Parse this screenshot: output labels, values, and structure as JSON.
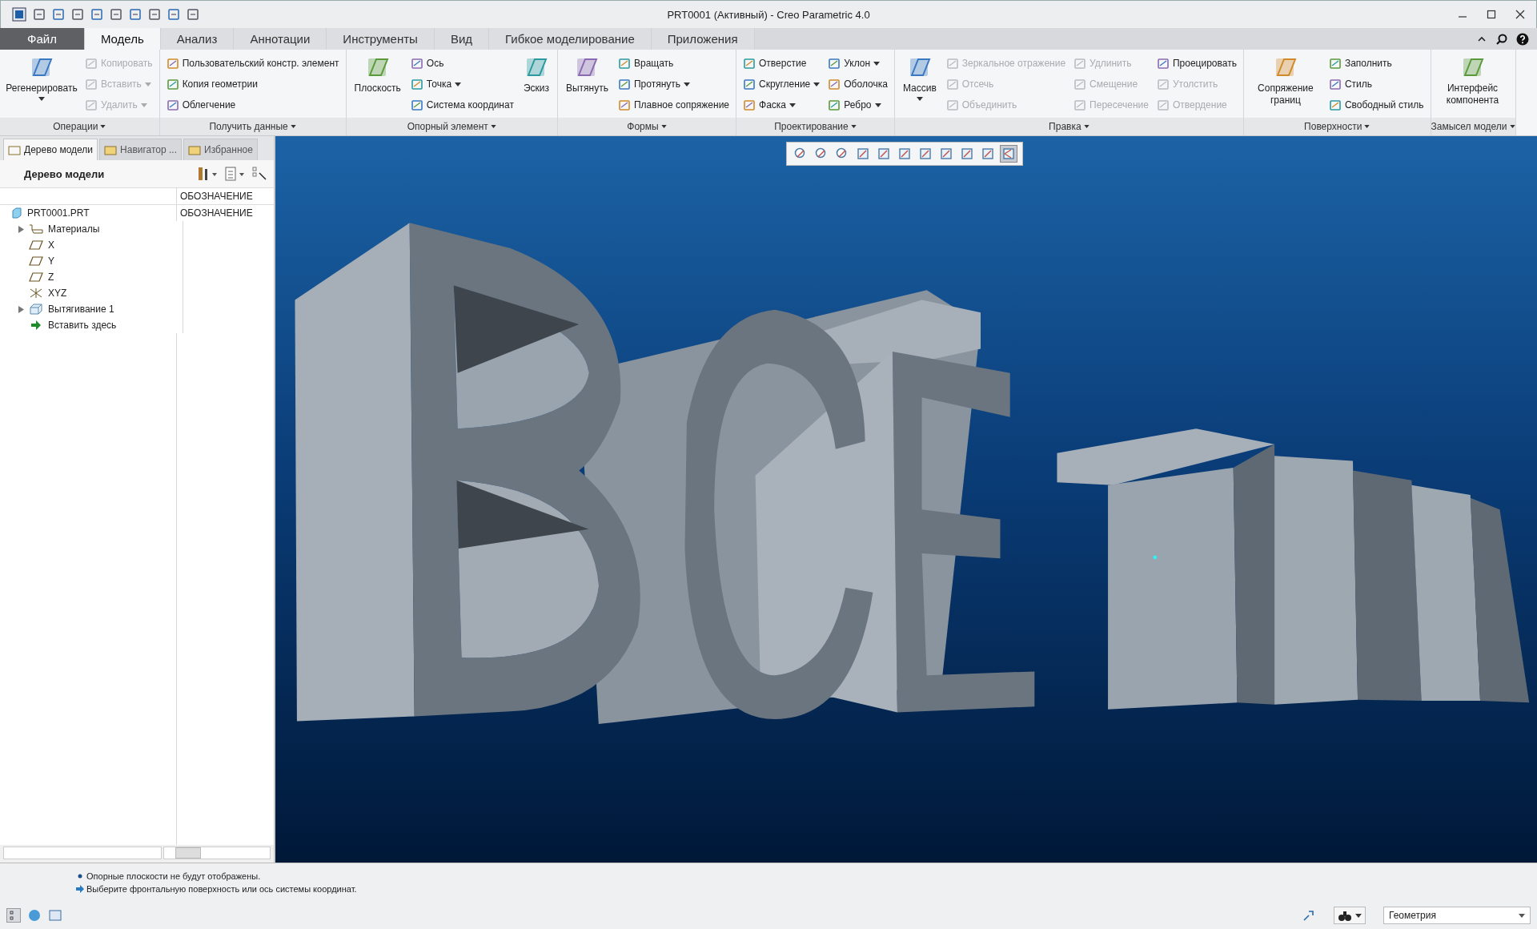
{
  "window": {
    "title": "PRT0001 (Активный) - Creo Parametric 4.0"
  },
  "tabs": [
    {
      "label": "Файл",
      "kind": "file",
      "selected": false
    },
    {
      "label": "Модель",
      "kind": "tab",
      "selected": true
    },
    {
      "label": "Анализ",
      "kind": "tab",
      "selected": false
    },
    {
      "label": "Аннотации",
      "kind": "tab",
      "selected": false
    },
    {
      "label": "Инструменты",
      "kind": "tab",
      "selected": false
    },
    {
      "label": "Вид",
      "kind": "tab",
      "selected": false
    },
    {
      "label": "Гибкое моделирование",
      "kind": "tab",
      "selected": false
    },
    {
      "label": "Приложения",
      "kind": "tab",
      "selected": false
    }
  ],
  "ribbon": [
    {
      "label": "Операции",
      "columns": [
        [
          {
            "label": "Регенерировать",
            "kind": "large",
            "dropdown": true,
            "disabled": false
          }
        ],
        [
          {
            "label": "Копировать",
            "kind": "small",
            "dropdown": false,
            "disabled": true
          },
          {
            "label": "Вставить",
            "kind": "small",
            "dropdown": true,
            "disabled": true
          },
          {
            "label": "Удалить",
            "kind": "small",
            "dropdown": true,
            "disabled": true
          }
        ]
      ]
    },
    {
      "label": "Получить данные",
      "columns": [
        [
          {
            "label": "Пользовательский констр. элемент",
            "kind": "small",
            "dropdown": false,
            "disabled": false
          },
          {
            "label": "Копия геометрии",
            "kind": "small",
            "dropdown": false,
            "disabled": false
          },
          {
            "label": "Облегчение",
            "kind": "small",
            "dropdown": false,
            "disabled": false
          }
        ]
      ]
    },
    {
      "label": "Опорный элемент",
      "columns": [
        [
          {
            "label": "Плоскость",
            "kind": "large",
            "dropdown": false,
            "disabled": false
          }
        ],
        [
          {
            "label": "Ось",
            "kind": "small",
            "dropdown": false,
            "disabled": false
          },
          {
            "label": "Точка",
            "kind": "small",
            "dropdown": true,
            "disabled": false
          },
          {
            "label": "Система координат",
            "kind": "small",
            "dropdown": false,
            "disabled": false
          }
        ],
        [
          {
            "label": "Эскиз",
            "kind": "large",
            "dropdown": false,
            "disabled": false
          }
        ]
      ]
    },
    {
      "label": "Формы",
      "columns": [
        [
          {
            "label": "Вытянуть",
            "kind": "large",
            "dropdown": false,
            "disabled": false
          }
        ],
        [
          {
            "label": "Вращать",
            "kind": "small",
            "dropdown": false,
            "disabled": false
          },
          {
            "label": "Протянуть",
            "kind": "small",
            "dropdown": true,
            "disabled": false
          },
          {
            "label": "Плавное сопряжение",
            "kind": "small",
            "dropdown": false,
            "disabled": false
          }
        ]
      ]
    },
    {
      "label": "Проектирование",
      "columns": [
        [
          {
            "label": "Отверстие",
            "kind": "small",
            "dropdown": false,
            "disabled": false
          },
          {
            "label": "Скругление",
            "kind": "small",
            "dropdown": true,
            "disabled": false
          },
          {
            "label": "Фаска",
            "kind": "small",
            "dropdown": true,
            "disabled": false
          }
        ],
        [
          {
            "label": "Уклон",
            "kind": "small",
            "dropdown": true,
            "disabled": false
          },
          {
            "label": "Оболочка",
            "kind": "small",
            "dropdown": false,
            "disabled": false
          },
          {
            "label": "Ребро",
            "kind": "small",
            "dropdown": true,
            "disabled": false
          }
        ]
      ]
    },
    {
      "label": "Правка",
      "columns": [
        [
          {
            "label": "Массив",
            "kind": "large",
            "dropdown": true,
            "disabled": false
          }
        ],
        [
          {
            "label": "Зеркальное отражение",
            "kind": "small",
            "dropdown": false,
            "disabled": true
          },
          {
            "label": "Отсечь",
            "kind": "small",
            "dropdown": false,
            "disabled": true
          },
          {
            "label": "Объединить",
            "kind": "small",
            "dropdown": false,
            "disabled": true
          }
        ],
        [
          {
            "label": "Удлинить",
            "kind": "small",
            "dropdown": false,
            "disabled": true
          },
          {
            "label": "Смещение",
            "kind": "small",
            "dropdown": false,
            "disabled": true
          },
          {
            "label": "Пересечение",
            "kind": "small",
            "dropdown": false,
            "disabled": true
          }
        ],
        [
          {
            "label": "Проецировать",
            "kind": "small",
            "dropdown": false,
            "disabled": false
          },
          {
            "label": "Утолстить",
            "kind": "small",
            "dropdown": false,
            "disabled": true
          },
          {
            "label": "Отвердение",
            "kind": "small",
            "dropdown": false,
            "disabled": true
          }
        ]
      ]
    },
    {
      "label": "Поверхности",
      "columns": [
        [
          {
            "label": "Сопряжение границ",
            "kind": "large",
            "dropdown": false,
            "disabled": false
          }
        ],
        [
          {
            "label": "Заполнить",
            "kind": "small",
            "dropdown": false,
            "disabled": false
          },
          {
            "label": "Стиль",
            "kind": "small",
            "dropdown": false,
            "disabled": false
          },
          {
            "label": "Свободный стиль",
            "kind": "small",
            "dropdown": false,
            "disabled": false
          }
        ]
      ]
    },
    {
      "label": "Замысел модели",
      "columns": [
        [
          {
            "label": "Интерфейс компонента",
            "kind": "large",
            "dropdown": false,
            "disabled": false
          }
        ]
      ]
    }
  ],
  "panel": {
    "tabs": [
      {
        "label": "Дерево модели",
        "selected": true
      },
      {
        "label": "Навигатор ...",
        "selected": false
      },
      {
        "label": "Избранное",
        "selected": false
      }
    ],
    "title": "Дерево модели",
    "column_heading": "ОБОЗНАЧЕНИЕ",
    "tree": [
      {
        "label": "PRT0001.PRT",
        "kind": "part",
        "value": "ОБОЗНАЧЕНИЕ",
        "children": [
          {
            "label": "Материалы",
            "kind": "material",
            "expanded": false
          },
          {
            "label": "X",
            "kind": "plane"
          },
          {
            "label": "Y",
            "kind": "plane"
          },
          {
            "label": "Z",
            "kind": "plane"
          },
          {
            "label": "XYZ",
            "kind": "csys"
          },
          {
            "label": "Вытягивание 1",
            "kind": "extrude",
            "expanded": false
          },
          {
            "label": "Вставить здесь",
            "kind": "insert"
          }
        ]
      }
    ]
  },
  "view_toolbar": [
    {
      "selected": false
    },
    {
      "selected": false
    },
    {
      "selected": false
    },
    {
      "selected": false
    },
    {
      "selected": false
    },
    {
      "selected": false
    },
    {
      "selected": false
    },
    {
      "selected": false
    },
    {
      "selected": false
    },
    {
      "selected": false
    },
    {
      "selected": true
    }
  ],
  "messages": [
    {
      "kind": "info",
      "text": "Опорные плоскости не будут отображены."
    },
    {
      "kind": "prompt",
      "text": "Выберите фронтальную поверхность или ось системы координат."
    }
  ],
  "filter": {
    "value": "Геометрия"
  }
}
